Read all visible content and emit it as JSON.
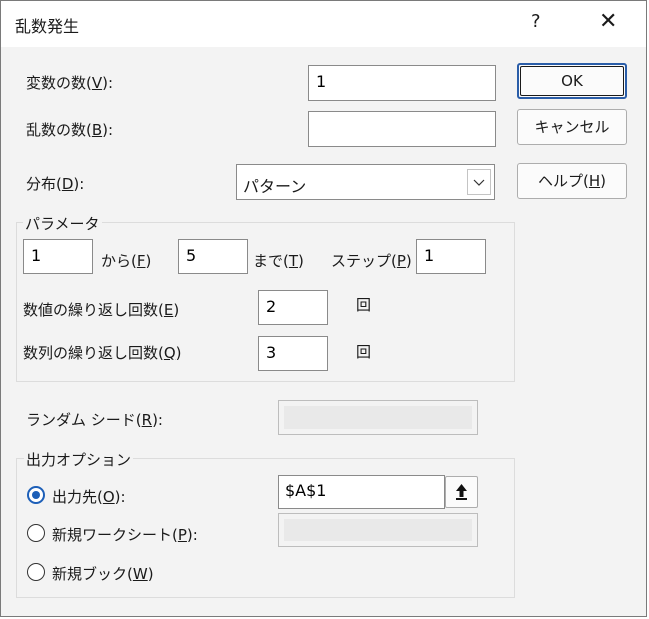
{
  "dialog": {
    "title": "乱数発生",
    "help_glyph": "?",
    "close_glyph": "✕"
  },
  "labels": {
    "num_vars": "変数の数(V):",
    "num_randoms": "乱数の数(B):",
    "distribution": "分布(D):",
    "random_seed": "ランダム シード(R):"
  },
  "fields": {
    "num_vars_value": "1",
    "num_randoms_value": "",
    "random_seed_value": ""
  },
  "distribution": {
    "selected": "パターン"
  },
  "buttons": {
    "ok": "OK",
    "cancel": "キャンセル",
    "help": "ヘルプ(H)"
  },
  "parameters": {
    "group_label": "パラメータ",
    "from_value": "1",
    "from_label": "から(F)",
    "to_value": "5",
    "to_label": "まで(T)",
    "step_label": "ステップ(P)",
    "step_value": "1",
    "repeat_each_label": "数値の繰り返し回数(E)",
    "repeat_each_value": "2",
    "repeat_each_unit": "回",
    "repeat_seq_label": "数列の繰り返し回数(Q)",
    "repeat_seq_value": "3",
    "repeat_seq_unit": "回"
  },
  "output": {
    "group_label": "出力オプション",
    "options": [
      {
        "label": "出力先(O):",
        "checked": true
      },
      {
        "label": "新規ワークシート(P):",
        "checked": false
      },
      {
        "label": "新規ブック(W)",
        "checked": false
      }
    ],
    "range_value": "$A$1"
  },
  "colors": {
    "accent": "#1d5fb8",
    "dialog_bg": "#f3f3f3"
  }
}
